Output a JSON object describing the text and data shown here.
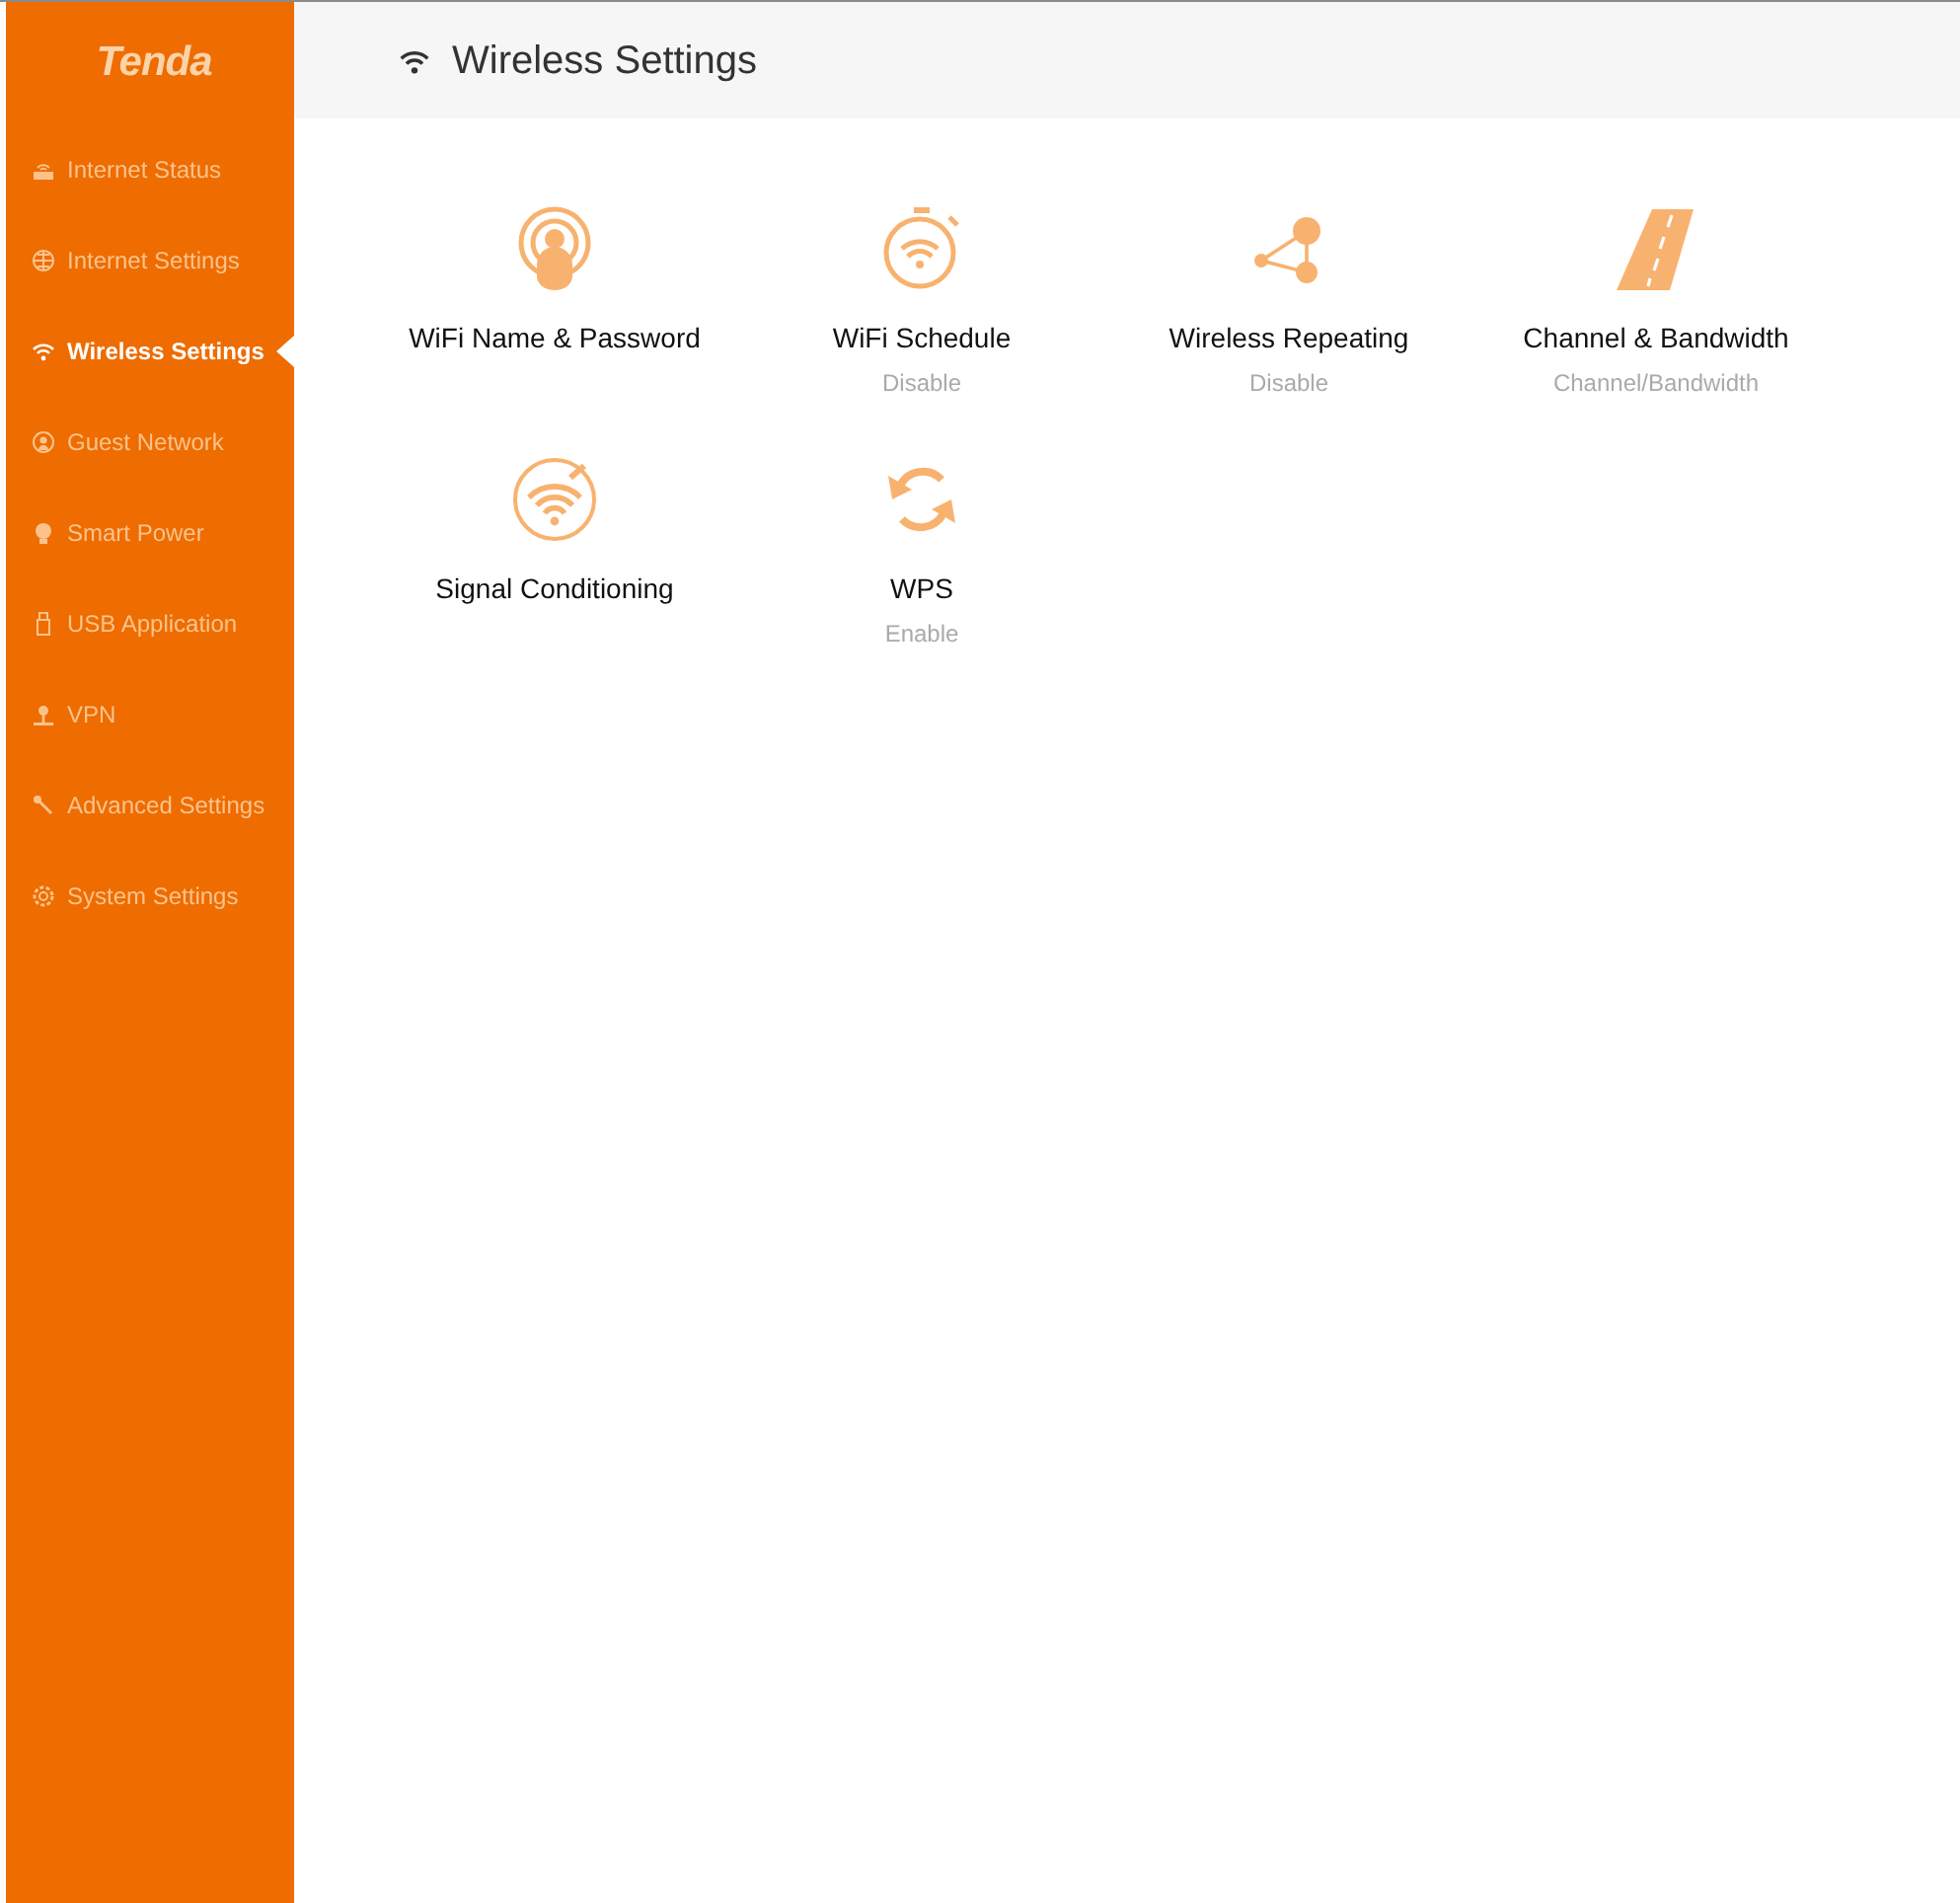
{
  "logo": "Tenda",
  "sidebar": {
    "items": [
      {
        "label": "Internet Status",
        "kind": "router",
        "selected": false
      },
      {
        "label": "Internet Settings",
        "kind": "globe",
        "selected": false
      },
      {
        "label": "Wireless Settings",
        "kind": "wifi",
        "selected": true
      },
      {
        "label": "Guest Network",
        "kind": "guest",
        "selected": false
      },
      {
        "label": "Smart Power",
        "kind": "bulb",
        "selected": false
      },
      {
        "label": "USB Application",
        "kind": "usb",
        "selected": false
      },
      {
        "label": "VPN",
        "kind": "vpn",
        "selected": false
      },
      {
        "label": "Advanced Settings",
        "kind": "tools",
        "selected": false
      },
      {
        "label": "System Settings",
        "kind": "gear",
        "selected": false
      }
    ]
  },
  "header": {
    "title": "Wireless Settings"
  },
  "tiles": [
    {
      "title": "WiFi Name & Password",
      "kind": "person"
    },
    {
      "title": "WiFi Schedule",
      "status": "Disable",
      "kind": "stopwatch"
    },
    {
      "title": "Wireless Repeating",
      "status": "Disable",
      "kind": "share"
    },
    {
      "title": "Channel & Bandwidth",
      "status": "Channel/Bandwidth",
      "kind": "road"
    },
    {
      "title": "Signal Conditioning",
      "kind": "signal"
    },
    {
      "title": "WPS",
      "status": "Enable",
      "kind": "sync"
    }
  ]
}
